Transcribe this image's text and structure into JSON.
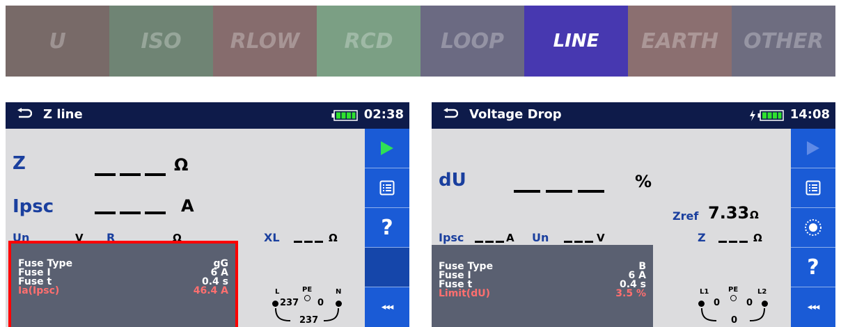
{
  "tabs": [
    {
      "label": "U",
      "color": "#786a68"
    },
    {
      "label": "ISO",
      "color": "#6f8474"
    },
    {
      "label": "RLOW",
      "color": "#866c6d"
    },
    {
      "label": "RCD",
      "color": "#7b9f84"
    },
    {
      "label": "LOOP",
      "color": "#6b6a82"
    },
    {
      "label": "LINE",
      "color": "#4738b0",
      "active": true
    },
    {
      "label": "EARTH",
      "color": "#8b6f70"
    },
    {
      "label": "OTHER",
      "color": "#6e6d80"
    }
  ],
  "zline": {
    "title": "Z line",
    "time": "02:38",
    "z_label": "Z",
    "z_unit": "Ω",
    "ipsc_label": "Ipsc",
    "ipsc_unit": "A",
    "un_label": "Un",
    "un_unit": "V",
    "r_label": "R",
    "r_unit": "Ω",
    "xl_label": "XL",
    "xl_unit": "Ω",
    "fuse_type_label": "Fuse Type",
    "fuse_type_value": "gG",
    "fuse_i_label": "Fuse I",
    "fuse_i_value": "6 A",
    "fuse_t_label": "Fuse t",
    "fuse_t_value": "0.4 s",
    "ia_label": "Ia(Ipsc)",
    "ia_value": "46.4 A",
    "term_l": "L",
    "term_pe": "PE",
    "term_n": "N",
    "v_lpe": "237",
    "v_pen": "0",
    "v_ln": "237",
    "sidebar": [
      "start-icon",
      "list-icon",
      "help-icon",
      "blank",
      "more-icon"
    ]
  },
  "vdrop": {
    "title": "Voltage Drop",
    "time": "14:08",
    "du_label": "dU",
    "du_unit": "%",
    "zref_label": "Zref",
    "zref_value": "7.33",
    "zref_unit": "Ω",
    "ipsc_label": "Ipsc",
    "ipsc_unit": "A",
    "un_label": "Un",
    "un_unit": "V",
    "z_label": "Z",
    "z_unit": "Ω",
    "fuse_type_label": "Fuse Type",
    "fuse_type_value": "B",
    "fuse_i_label": "Fuse I",
    "fuse_i_value": "6 A",
    "fuse_t_label": "Fuse t",
    "fuse_t_value": "0.4 s",
    "limit_label": "Limit(dU)",
    "limit_value": "3.5 %",
    "term_l1": "L1",
    "term_pe": "PE",
    "term_l2": "L2",
    "v_l1pe": "0",
    "v_pel2": "0",
    "v_l1l2": "0",
    "sidebar": [
      "start-icon-disabled",
      "list-icon",
      "zref-icon",
      "help-icon",
      "more-icon"
    ]
  }
}
